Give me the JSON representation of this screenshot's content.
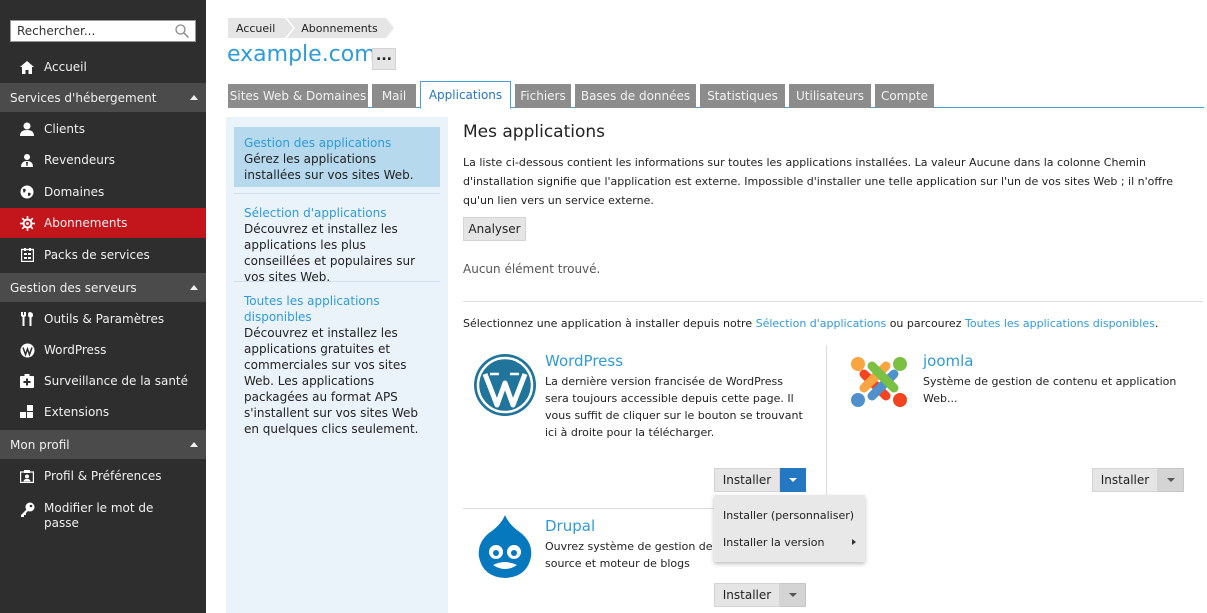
{
  "search": {
    "placeholder": "Rechercher..."
  },
  "sidebar": {
    "home": "Accueil",
    "sections": [
      {
        "label": "Services d'hébergement",
        "items": [
          "Clients",
          "Revendeurs",
          "Domaines",
          "Abonnements",
          "Packs de services"
        ]
      },
      {
        "label": "Gestion des serveurs",
        "items": [
          "Outils & Paramètres",
          "WordPress",
          "Surveillance de la santé",
          "Extensions"
        ]
      },
      {
        "label": "Mon profil",
        "items": [
          "Profil & Préférences",
          "Modifier le mot de passe"
        ]
      }
    ],
    "active_item": "Abonnements",
    "active_color": "#c3161c"
  },
  "breadcrumb": [
    "Accueil",
    "Abonnements"
  ],
  "page_title": "example.com",
  "more_label": "...",
  "tabs": [
    "Sites Web & Domaines",
    "Mail",
    "Applications",
    "Fichiers",
    "Bases de données",
    "Statistiques",
    "Utilisateurs",
    "Compte"
  ],
  "active_tab": "Applications",
  "left_panel": [
    {
      "link": "Gestion des applications",
      "desc": "Gérez les applications installées sur vos sites Web."
    },
    {
      "link": "Sélection d'applications",
      "desc": "Découvrez et installez les applications les plus conseillées et populaires sur vos sites Web."
    },
    {
      "link": "Toutes les applications disponibles",
      "desc": "Découvrez et installez les applications gratuites et commerciales sur vos sites Web. Les applications packagées au format APS s'installent sur vos sites Web en quelques clics seulement."
    }
  ],
  "main": {
    "title": "Mes applications",
    "description": "La liste ci-dessous contient les informations sur toutes les applications installées. La valeur Aucune dans la colonne Chemin d'installation signifie que l'application est externe. Impossible d'installer une telle application sur l'un de vos sites Web ; il n'offre qu'un lien vers un service externe.",
    "analyze_label": "Analyser",
    "no_items": "Aucun élément trouvé.",
    "select_prefix": "Sélectionnez une application à installer depuis notre ",
    "select_link1": "Sélection d'applications",
    "select_middle": " ou parcourez ",
    "select_link2": "Toutes les applications disponibles",
    "select_suffix": "."
  },
  "apps": [
    {
      "name": "WordPress",
      "desc": "La dernière version francisée de WordPress sera toujours accessible depuis cette page. Il vous suffit de cliquer sur le bouton se trouvant ici à droite pour la télécharger.",
      "install_label": "Installer",
      "logo": "wordpress-logo"
    },
    {
      "name": "joomla",
      "desc": "Système de gestion de contenu et application Web...",
      "install_label": "Installer",
      "logo": "joomla-logo"
    },
    {
      "name": "Drupal",
      "desc": "Ouvrez système de gestion de source et moteur de blogs",
      "install_label": "Installer",
      "logo": "drupal-logo"
    }
  ],
  "dropdown": [
    "Installer (personnaliser)",
    "Installer la version"
  ],
  "colors": {
    "link": "#2f9bd8",
    "accent": "#2478c2",
    "sidebar_bg": "#2e2e2e",
    "section_bg": "#4b4b4b"
  }
}
